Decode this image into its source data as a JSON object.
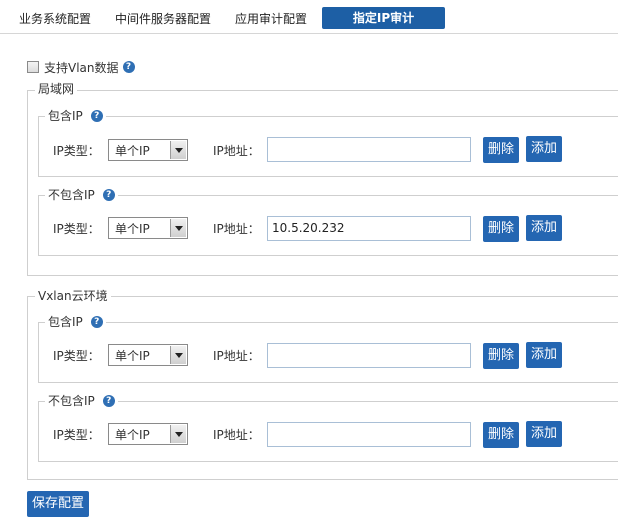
{
  "tabs": [
    {
      "label": "业务系统配置",
      "active": false
    },
    {
      "label": "中间件服务器配置",
      "active": false
    },
    {
      "label": "应用审计配置",
      "active": false
    },
    {
      "label": "指定IP审计",
      "active": true
    }
  ],
  "vlan_support": {
    "label": "支持Vlan数据",
    "checked": false,
    "help": "?"
  },
  "sections": [
    {
      "title": "局域网",
      "groups": [
        {
          "title": "包含IP",
          "help": "?",
          "type_label": "IP类型：",
          "type_value": "单个IP",
          "addr_label": "IP地址：",
          "addr_value": "",
          "delete": "删除",
          "add": "添加"
        },
        {
          "title": "不包含IP",
          "help": "?",
          "type_label": "IP类型：",
          "type_value": "单个IP",
          "addr_label": "IP地址：",
          "addr_value": "10.5.20.232",
          "delete": "删除",
          "add": "添加"
        }
      ]
    },
    {
      "title": "Vxlan云环境",
      "groups": [
        {
          "title": "包含IP",
          "help": "?",
          "type_label": "IP类型：",
          "type_value": "单个IP",
          "addr_label": "IP地址：",
          "addr_value": "",
          "delete": "删除",
          "add": "添加"
        },
        {
          "title": "不包含IP",
          "help": "?",
          "type_label": "IP类型：",
          "type_value": "单个IP",
          "addr_label": "IP地址：",
          "addr_value": "",
          "delete": "删除",
          "add": "添加"
        }
      ]
    }
  ],
  "save_button": "保存配置",
  "colors": {
    "accent": "#1d5fa5",
    "button": "#2466b2",
    "border": "#cfcfcf"
  }
}
